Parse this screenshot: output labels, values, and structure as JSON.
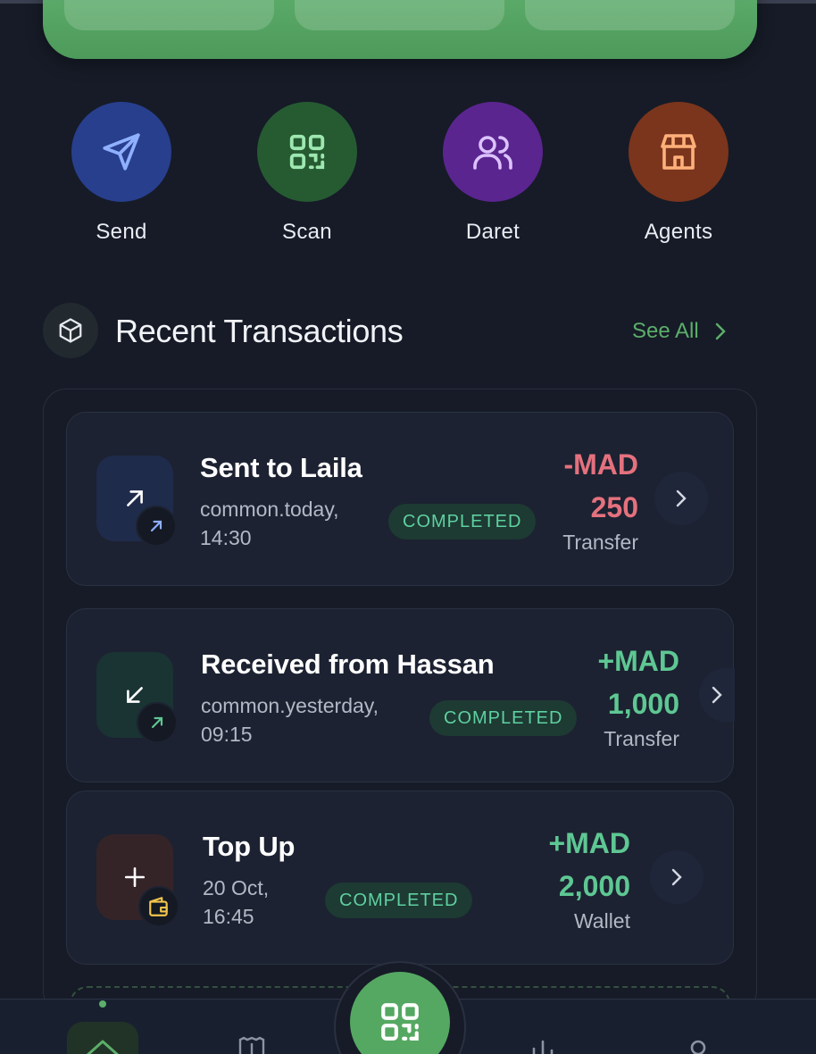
{
  "colors": {
    "background": "#161b27",
    "accent_green": "#5cae6a",
    "send": "#283f8e",
    "scan": "#265b32",
    "daret": "#5b2590",
    "agents": "#7a351c",
    "negative": "#e5717e",
    "positive": "#5ec793"
  },
  "quick_actions": [
    {
      "label": "Send",
      "icon": "send-icon"
    },
    {
      "label": "Scan",
      "icon": "qr-code-icon"
    },
    {
      "label": "Daret",
      "icon": "users-icon"
    },
    {
      "label": "Agents",
      "icon": "store-icon"
    }
  ],
  "transactions_section": {
    "title": "Recent Transactions",
    "see_all_label": "See All"
  },
  "transactions": [
    {
      "title": "Sent to Laila",
      "date_line1": "common.today,",
      "date_line2": "14:30",
      "status": "COMPLETED",
      "amount_line1": "-MAD",
      "amount_line2": "250",
      "type": "Transfer",
      "icon": "arrow-up-right-icon",
      "badge_icon": "arrow-up-right-icon"
    },
    {
      "title": "Received from Hassan",
      "date_line1": "common.yesterday,",
      "date_line2": "09:15",
      "status": "COMPLETED",
      "amount_line1": "+MAD",
      "amount_line2": "1,000",
      "type": "Transfer",
      "icon": "arrow-down-left-icon",
      "badge_icon": "arrow-up-right-icon"
    },
    {
      "title": "Top Up",
      "date_line1": "20 Oct,",
      "date_line2": "16:45",
      "status": "COMPLETED",
      "amount_line1": "+MAD",
      "amount_line2": "2,000",
      "type": "Wallet",
      "icon": "plus-icon",
      "badge_icon": "wallet-icon"
    }
  ],
  "bottom_nav": {
    "items": [
      "home-icon",
      "receipt-icon",
      "qr-code-icon",
      "chart-icon",
      "profile-icon"
    ],
    "active": "home-icon"
  }
}
